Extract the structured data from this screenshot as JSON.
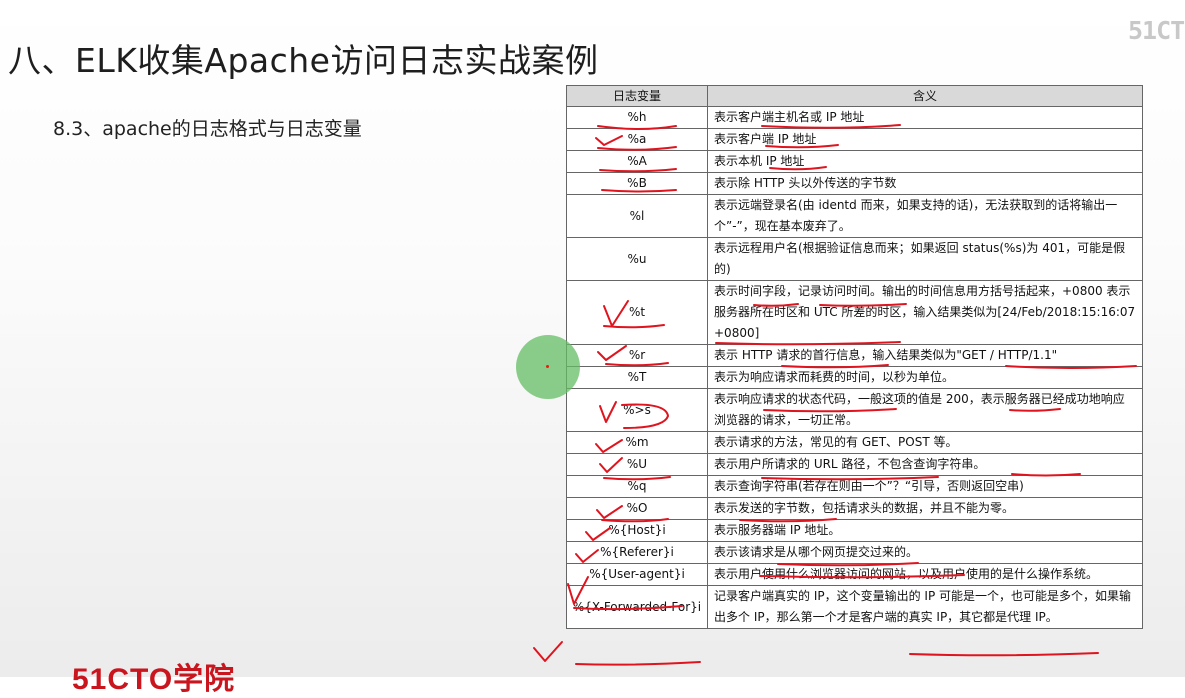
{
  "slide": {
    "title": "八、ELK收集Apache访问日志实战案例",
    "subtitle": "8.3、apache的日志格式与日志变量"
  },
  "logos": {
    "top_right": "51CT",
    "bottom_left": "51CTO学院"
  },
  "table": {
    "headers": [
      "日志变量",
      "含义"
    ],
    "rows": [
      {
        "var": "%h",
        "desc": "表示客户端主机名或 IP 地址"
      },
      {
        "var": "%a",
        "desc": "表示客户端 IP 地址"
      },
      {
        "var": "%A",
        "desc": "表示本机 IP 地址"
      },
      {
        "var": "%B",
        "desc": "表示除 HTTP 头以外传送的字节数"
      },
      {
        "var": "%l",
        "desc": "表示远端登录名(由 identd 而来，如果支持的话)，无法获取到的话将输出一个”-”，现在基本废弃了。"
      },
      {
        "var": "%u",
        "desc": "表示远程用户名(根据验证信息而来；如果返回 status(%s)为 401，可能是假的)"
      },
      {
        "var": "%t",
        "desc": "表示时间字段，记录访问时间。输出的时间信息用方括号括起来，+0800 表示服务器所在时区和 UTC 所差的时区，输入结果类似为[24/Feb/2018:15:16:07 +0800]"
      },
      {
        "var": "%r",
        "desc": "表示 HTTP 请求的首行信息，输入结果类似为\"GET / HTTP/1.1\""
      },
      {
        "var": "%T",
        "desc": "表示为响应请求而耗费的时间，以秒为单位。"
      },
      {
        "var": "%>s",
        "desc": "表示响应请求的状态代码，一般这项的值是 200，表示服务器已经成功地响应浏览器的请求，一切正常。"
      },
      {
        "var": "%m",
        "desc": "表示请求的方法，常见的有 GET、POST 等。"
      },
      {
        "var": "%U",
        "desc": "表示用户所请求的 URL 路径，不包含查询字符串。"
      },
      {
        "var": "%q",
        "desc": "表示查询字符串(若存在则由一个”？“引导，否则返回空串)"
      },
      {
        "var": "%O",
        "desc": "表示发送的字节数，包括请求头的数据，并且不能为零。"
      },
      {
        "var": "%{Host}i",
        "desc": "表示服务器端 IP 地址。"
      },
      {
        "var": "%{Referer}i",
        "desc": "表示该请求是从哪个网页提交过来的。"
      },
      {
        "var": "%{User-agent}i",
        "desc": "表示用户使用什么浏览器访问的网站，以及用户使用的是什么操作系统。"
      },
      {
        "var": "%{X-Forwarded-For}i",
        "desc": "记录客户端真实的 IP，这个变量输出的 IP 可能是一个，也可能是多个，如果输出多个 IP，那么第一个才是客户端的真实 IP，其它都是代理 IP。"
      }
    ]
  },
  "colors": {
    "annotation": "#e0141e",
    "header_bg": "#d9d9d9",
    "cursor_highlight": "#64be64"
  }
}
